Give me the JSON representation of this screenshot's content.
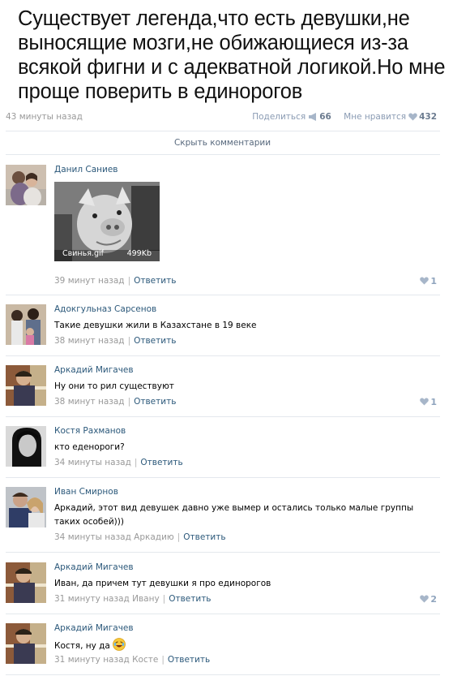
{
  "post": {
    "text": "Существует легенда,что есть девушки,не выносящие мозги,не обижающиеся из-за всякой фигни и с адекватной логикой.Но мне проще поверить в единорогов",
    "time": "43 минуты назад",
    "share_label": "Поделиться",
    "share_count": "66",
    "like_label": "Мне нравится",
    "like_count": "432"
  },
  "comments_header": {
    "hide_label": "Скрыть комментарии"
  },
  "comments": [
    {
      "author": "Данил Саниев",
      "text": "",
      "attachment": {
        "name": "Свинья.gif",
        "size": "499Kb"
      },
      "time": "39 минут назад",
      "reply": "Ответить",
      "likes": "1"
    },
    {
      "author": "Адокгульназ Сарсенов",
      "text": "Такие девушки жили в Казахстане в 19 веке",
      "time": "38 минут назад",
      "reply": "Ответить",
      "likes": ""
    },
    {
      "author": "Аркадий Мигачев",
      "text": "Ну они то рил существуют",
      "time": "38 минут назад",
      "reply": "Ответить",
      "likes": "1"
    },
    {
      "author": "Костя Рахманов",
      "text": "кто еденороги?",
      "time": "34 минуты назад",
      "reply": "Ответить",
      "likes": ""
    },
    {
      "author": "Иван Смирнов",
      "text": "Аркадий, этот вид девушек давно уже вымер и остались только малые группы таких особей)))",
      "time": "34 минуты назад Аркадию",
      "reply": "Ответить",
      "likes": ""
    },
    {
      "author": "Аркадий Мигачев",
      "text": "Иван, да причем тут девушки я про единорогов",
      "time": "31 минуту назад Ивану",
      "reply": "Ответить",
      "likes": "2"
    },
    {
      "author": "Аркадий Мигачев",
      "text": "Костя, ну да",
      "emoji": "laughing-emoji",
      "time": "31 минуту назад Косте",
      "reply": "Ответить",
      "likes": ""
    }
  ],
  "icons": {
    "share": "megaphone-icon",
    "like": "heart-icon"
  },
  "colors": {
    "link": "#2b587a",
    "meta": "#999999",
    "heart": "#8fa4bd",
    "divider": "#e4e8ed"
  }
}
